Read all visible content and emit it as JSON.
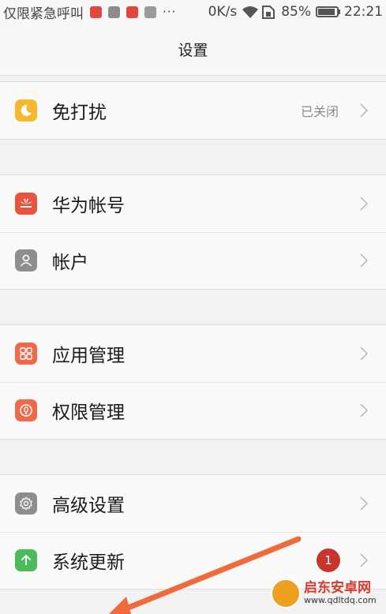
{
  "statusbar": {
    "carrier": "仅限紧急呼叫",
    "more": "···",
    "rate": "0K/s",
    "battery_pct": "85%",
    "time": "22:21"
  },
  "header": {
    "title": "设置"
  },
  "groups": [
    {
      "items": [
        {
          "label": "免打扰",
          "value": "已关闭",
          "icon": "moon-icon",
          "color": "#f5b82e"
        }
      ]
    },
    {
      "items": [
        {
          "label": "华为帐号",
          "icon": "huawei-icon",
          "color": "#e8533b"
        },
        {
          "label": "帐户",
          "icon": "account-icon",
          "color": "#8e8e8e"
        }
      ]
    },
    {
      "items": [
        {
          "label": "应用管理",
          "icon": "apps-grid-icon",
          "color": "#ef6a4a"
        },
        {
          "label": "权限管理",
          "icon": "permission-icon",
          "color": "#ef6a4a"
        }
      ]
    },
    {
      "items": [
        {
          "label": "高级设置",
          "icon": "gear-icon",
          "color": "#8e8e8e"
        },
        {
          "label": "系统更新",
          "icon": "update-arrow-icon",
          "color": "#4cbb5c",
          "badge": "1"
        }
      ]
    }
  ],
  "watermark": {
    "title": "启东安卓网",
    "url": "www.qdltdq.com"
  }
}
